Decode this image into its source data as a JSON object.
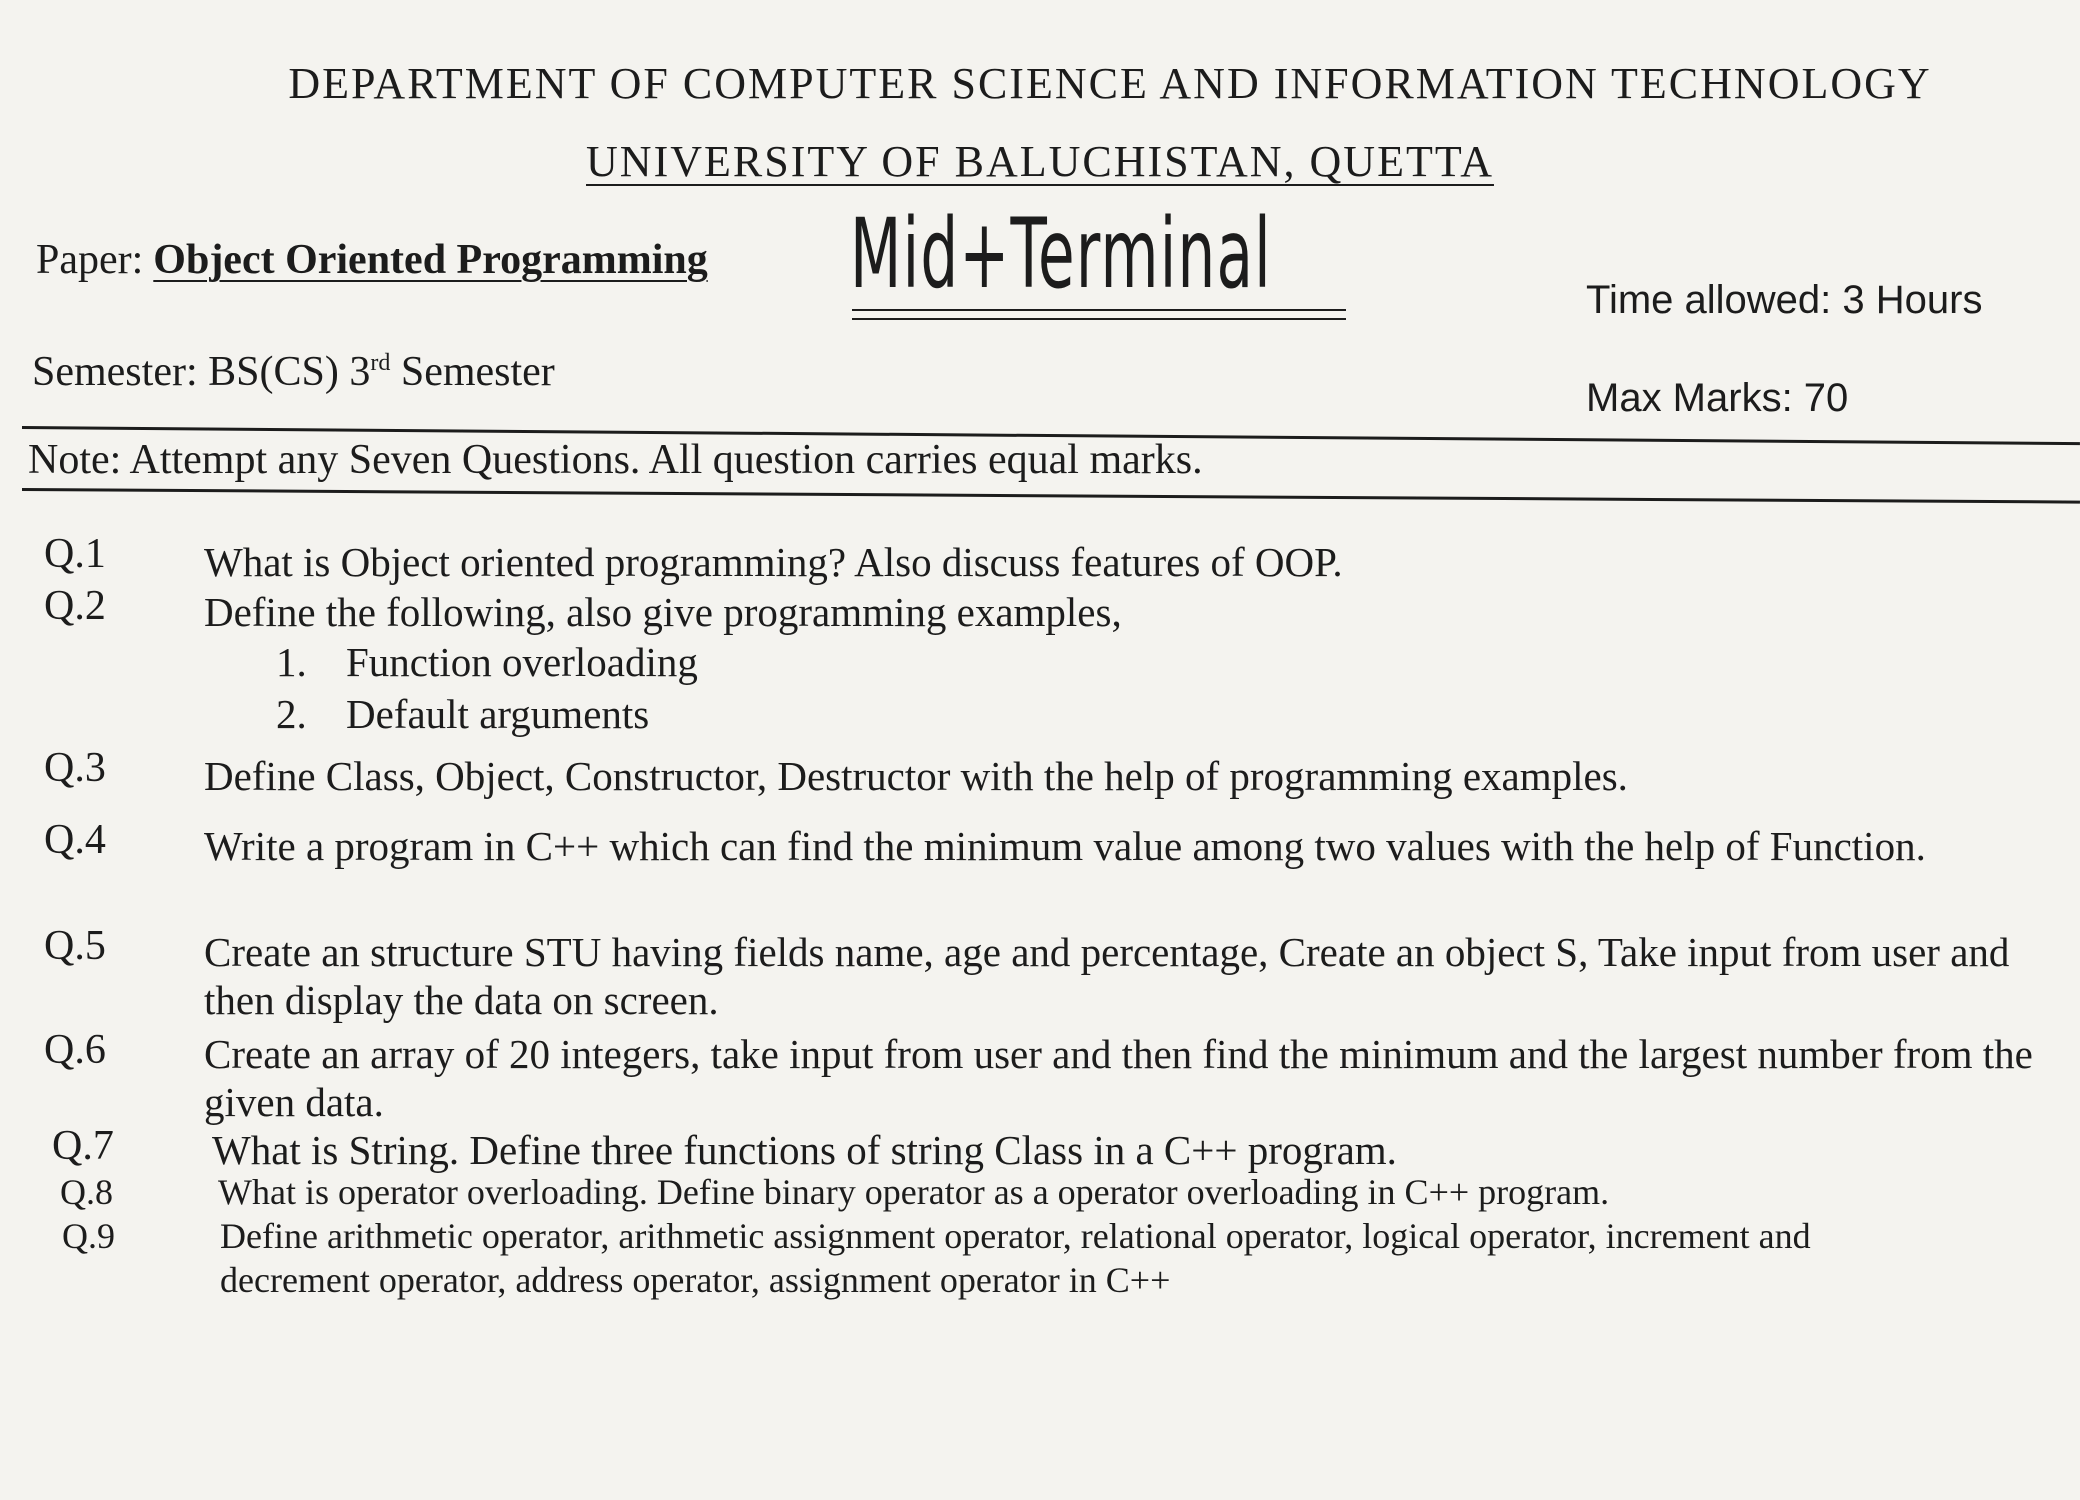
{
  "header": {
    "department": "DEPARTMENT OF COMPUTER SCIENCE AND INFORMATION TECHNOLOGY",
    "university": "UNIVERSITY OF BALUCHISTAN, QUETTA"
  },
  "exam": {
    "paper_label": "Paper:",
    "paper_title": "Object Oriented Programming",
    "exam_type": "Mid+Terminal",
    "time_allowed": "Time allowed:  3 Hours",
    "semester_prefix": "Semester: BS(CS) 3",
    "semester_sup": "rd",
    "semester_suffix": " Semester",
    "max_marks": "Max Marks:  70"
  },
  "note": "Note:  Attempt any Seven Questions. All question carries equal marks.",
  "questions": [
    {
      "label": "Q.1",
      "text": "What is Object oriented programming? Also discuss features of OOP."
    },
    {
      "label": "Q.2",
      "text": "Define the following, also give programming examples,",
      "sub_items": [
        {
          "num": "1.",
          "text": "Function overloading"
        },
        {
          "num": "2.",
          "text": "Default arguments"
        }
      ]
    },
    {
      "label": "Q.3",
      "text": "Define Class, Object, Constructor, Destructor with the help of programming examples."
    },
    {
      "label": "Q.4",
      "text": "Write a program in C++ which can find the minimum value among two values with the help of Function."
    },
    {
      "label": "Q.5",
      "text": "Create an structure STU having fields name, age and percentage, Create an object S, Take input from user and then display the data on screen."
    },
    {
      "label": "Q.6",
      "text": "Create an array of 20 integers, take input from user and then find the minimum and the largest number from the given data."
    },
    {
      "label": "Q.7",
      "text": "What is String. Define three functions of string Class in a C++ program."
    },
    {
      "label": "Q.8",
      "text": "What is operator overloading. Define binary operator as a operator overloading in C++ program."
    },
    {
      "label": "Q.9",
      "text": "Define arithmetic operator, arithmetic assignment operator, relational operator, logical operator, increment and decrement operator, address operator, assignment operator in C++"
    }
  ]
}
